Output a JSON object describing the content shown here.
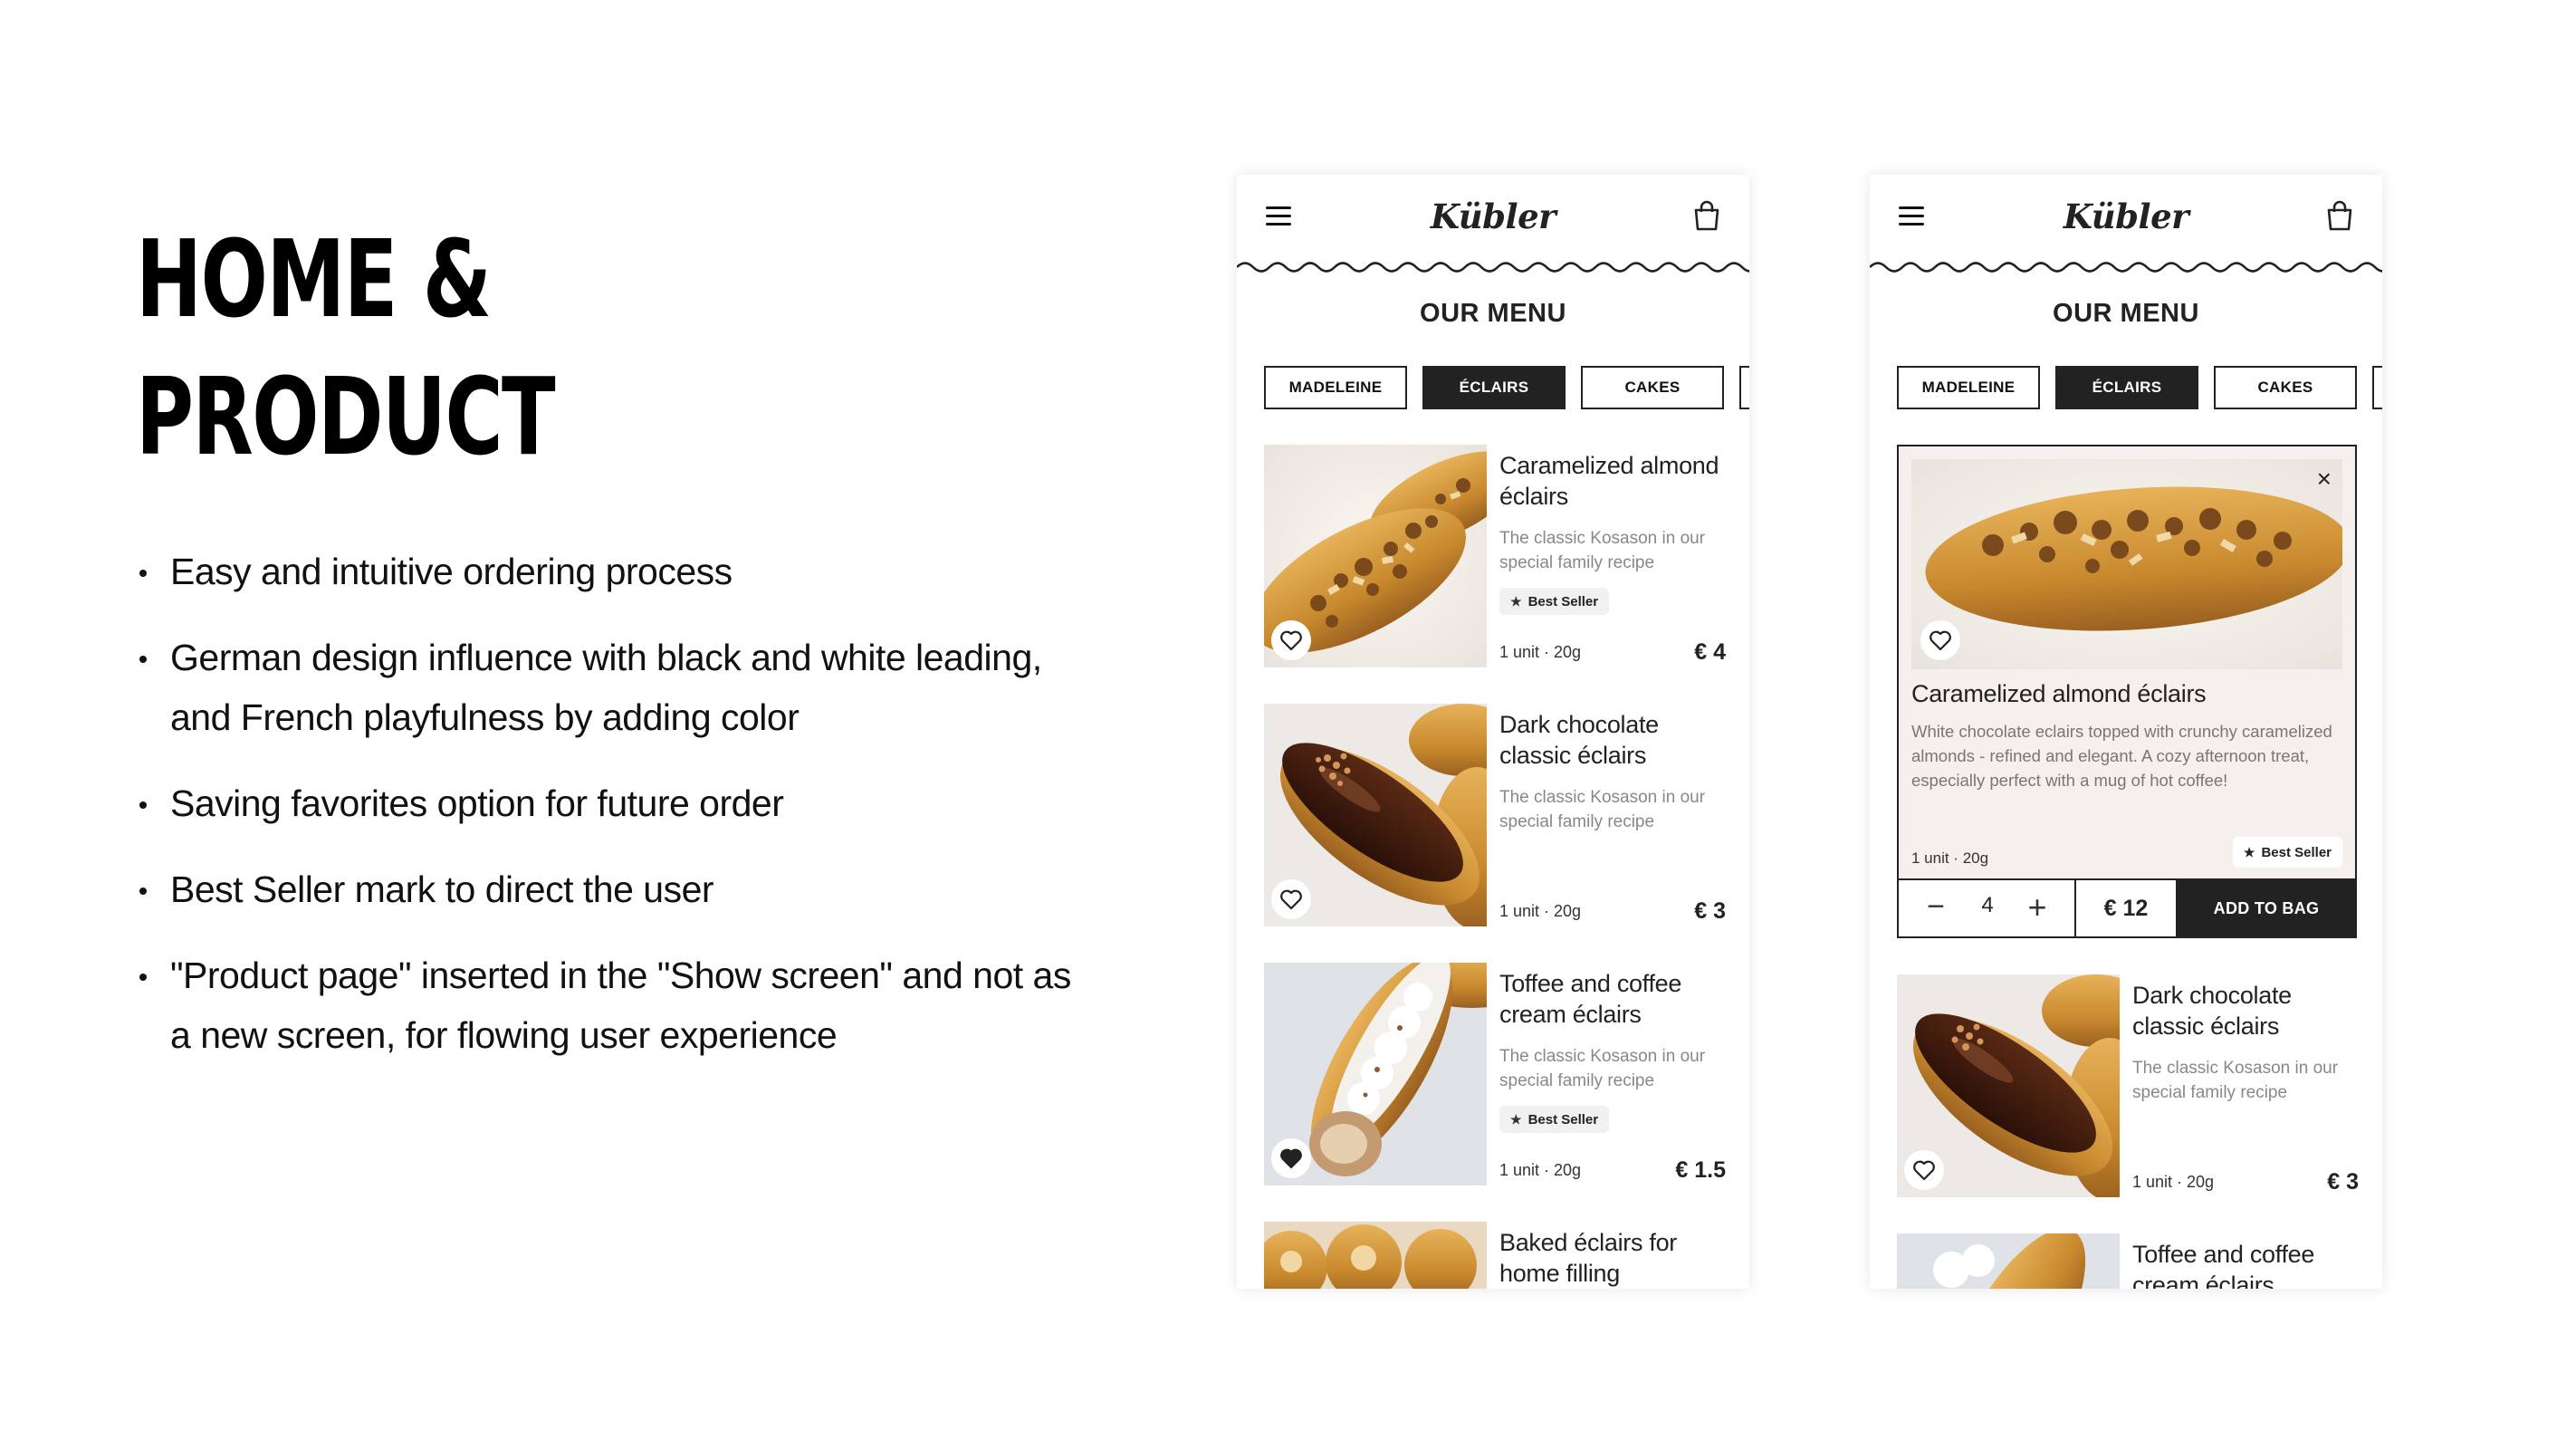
{
  "slide": {
    "title_line1": "HOME  &",
    "title_line2": "PRODUCT",
    "bullets": [
      "Easy and intuitive ordering process",
      "German design influence with black and white leading, and French playfulness by adding color",
      "Saving favorites option for future order",
      "Best Seller mark to direct the user",
      "\"Product page\" inserted in the \"Show screen\" and not as a new screen, for flowing user experience"
    ]
  },
  "app": {
    "brand": "Kübler",
    "section_title": "OUR MENU",
    "tabs": [
      "MADELEINE",
      "ÉCLAIRS",
      "CAKES",
      ""
    ],
    "active_tab": "ÉCLAIRS"
  },
  "phone1": {
    "products": [
      {
        "name": "Caramelized almond éclairs",
        "desc": "The classic Kosason in our special family recipe",
        "badge": "Best Seller",
        "meta": "1 unit · 20g",
        "price": "€ 4",
        "favorite": false
      },
      {
        "name": "Dark chocolate classic éclairs",
        "desc": "The classic Kosason in our special family recipe",
        "badge": "",
        "meta": "1 unit · 20g",
        "price": "€ 3",
        "favorite": false
      },
      {
        "name": "Toffee and coffee cream éclairs",
        "desc": "The classic Kosason in our special family recipe",
        "badge": "Best Seller",
        "meta": "1 unit · 20g",
        "price": "€ 1.5",
        "favorite": true
      },
      {
        "name": "Baked éclairs for home filling"
      }
    ]
  },
  "phone2": {
    "expanded": {
      "name": "Caramelized almond éclairs",
      "desc": "White chocolate eclairs topped with crunchy caramelized almonds - refined and elegant. A cozy afternoon treat, especially perfect with a mug of hot coffee!",
      "meta": "1 unit · 20g",
      "badge": "Best Seller",
      "quantity": "4",
      "total": "€ 12",
      "add_to_bag": "ADD TO BAG",
      "close": "×",
      "minus": "−",
      "plus": "+"
    },
    "products": [
      {
        "name": "Dark chocolate classic éclairs",
        "desc": "The classic Kosason in our special family recipe",
        "meta": "1 unit · 20g",
        "price": "€ 3"
      },
      {
        "name": "Toffee and coffee cream éclairs"
      }
    ]
  },
  "colors": {
    "ink": "#222222",
    "page_background": "#ffffff",
    "expanded_background": "#f5efee",
    "muted_text": "#888888"
  },
  "icons": {
    "menu": "hamburger-icon",
    "bag": "shopping-bag-icon",
    "favorite": "heart-icon",
    "best_seller": "star-icon",
    "close": "close-icon"
  }
}
